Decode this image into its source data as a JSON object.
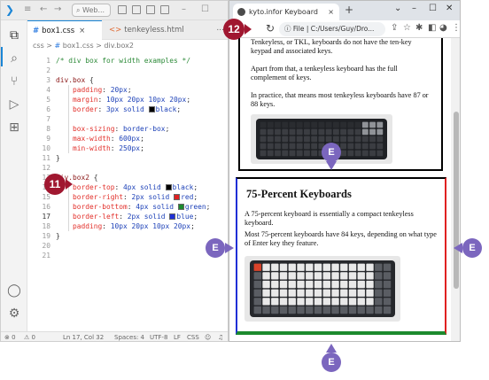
{
  "vscode": {
    "title_search": "Web...",
    "tabs": [
      {
        "lang": "#",
        "label": "box1.css",
        "close": "×"
      },
      {
        "lang": "<>",
        "label": "tenkeyless.html",
        "close": ""
      }
    ],
    "tabs_more": "...",
    "breadcrumb": {
      "file": "css",
      "sep": ">",
      "hash": "#",
      "name": "box1.css",
      "sep2": ">",
      "selector": "div.box2"
    },
    "lines": [
      {
        "n": "1",
        "tokens": [
          [
            "c-com",
            "/* div box for width examples */"
          ]
        ]
      },
      {
        "n": "2",
        "tokens": []
      },
      {
        "n": "3",
        "tokens": [
          [
            "c-sel",
            "div.box"
          ],
          [
            "",
            " {"
          ]
        ]
      },
      {
        "n": "4",
        "tokens": [
          [
            "",
            "    "
          ],
          [
            "c-prop",
            "padding"
          ],
          [
            "",
            ": "
          ],
          [
            "c-val",
            "20px"
          ],
          [
            "",
            ";"
          ]
        ]
      },
      {
        "n": "5",
        "tokens": [
          [
            "",
            "    "
          ],
          [
            "c-prop",
            "margin"
          ],
          [
            "",
            ": "
          ],
          [
            "c-val",
            "10px 20px 10px 20px"
          ],
          [
            "",
            ";"
          ]
        ]
      },
      {
        "n": "6",
        "tokens": [
          [
            "",
            "    "
          ],
          [
            "c-prop",
            "border"
          ],
          [
            "",
            ": "
          ],
          [
            "c-val",
            "3px solid "
          ],
          [
            "sw:#000000",
            ""
          ],
          [
            "c-val",
            "black"
          ],
          [
            "",
            ";"
          ]
        ]
      },
      {
        "n": "7",
        "tokens": []
      },
      {
        "n": "8",
        "tokens": [
          [
            "",
            "    "
          ],
          [
            "c-prop",
            "box-sizing"
          ],
          [
            "",
            ": "
          ],
          [
            "c-val",
            "border-box"
          ],
          [
            "",
            ";"
          ]
        ]
      },
      {
        "n": "9",
        "tokens": [
          [
            "",
            "    "
          ],
          [
            "c-prop",
            "max-width"
          ],
          [
            "",
            ": "
          ],
          [
            "c-val",
            "600px"
          ],
          [
            "",
            ";"
          ]
        ]
      },
      {
        "n": "10",
        "tokens": [
          [
            "",
            "    "
          ],
          [
            "c-prop",
            "min-width"
          ],
          [
            "",
            ": "
          ],
          [
            "c-val",
            "250px"
          ],
          [
            "",
            ";"
          ]
        ]
      },
      {
        "n": "11",
        "tokens": [
          [
            "",
            "}"
          ]
        ]
      },
      {
        "n": "12",
        "tokens": []
      },
      {
        "n": "13",
        "tokens": [
          [
            "c-sel",
            "div.box2"
          ],
          [
            "",
            " {"
          ]
        ]
      },
      {
        "n": "14",
        "tokens": [
          [
            "",
            "    "
          ],
          [
            "c-prop",
            "border-top"
          ],
          [
            "",
            ": "
          ],
          [
            "c-val",
            "4px solid "
          ],
          [
            "sw:#000000",
            ""
          ],
          [
            "c-val",
            "black"
          ],
          [
            "",
            ";"
          ]
        ]
      },
      {
        "n": "15",
        "tokens": [
          [
            "",
            "    "
          ],
          [
            "c-prop",
            "border-right"
          ],
          [
            "",
            ": "
          ],
          [
            "c-val",
            "2px solid "
          ],
          [
            "sw:#e02020",
            ""
          ],
          [
            "c-val",
            "red"
          ],
          [
            "",
            ";"
          ]
        ]
      },
      {
        "n": "16",
        "tokens": [
          [
            "",
            "    "
          ],
          [
            "c-prop",
            "border-bottom"
          ],
          [
            "",
            ": "
          ],
          [
            "c-val",
            "4px solid "
          ],
          [
            "sw:#1c8a2e",
            ""
          ],
          [
            "c-val",
            "green"
          ],
          [
            "",
            ";"
          ]
        ]
      },
      {
        "n": "17",
        "tokens": [
          [
            "",
            "    "
          ],
          [
            "c-prop",
            "border-left"
          ],
          [
            "",
            ": "
          ],
          [
            "c-val",
            "2px solid "
          ],
          [
            "sw:#1f2fd6",
            ""
          ],
          [
            "c-val",
            "blue"
          ],
          [
            "",
            ";"
          ]
        ]
      },
      {
        "n": "18",
        "tokens": [
          [
            "",
            "    "
          ],
          [
            "c-prop",
            "padding"
          ],
          [
            "",
            ": "
          ],
          [
            "c-val",
            "10px 20px 10px 20px"
          ],
          [
            "",
            ";"
          ]
        ]
      },
      {
        "n": "19",
        "tokens": [
          [
            "",
            "}"
          ]
        ]
      },
      {
        "n": "20",
        "tokens": []
      },
      {
        "n": "21",
        "tokens": []
      }
    ],
    "current_line": "17",
    "status": {
      "errors": "⊗ 0",
      "warnings": "⚠ 0",
      "position": "Ln 17, Col 32",
      "spaces": "Spaces: 4",
      "encoding": "UTF-8",
      "eol": "LF",
      "language": "CSS"
    }
  },
  "browser": {
    "tab_title": "kyto.infor Keyboard Categories",
    "tab_close": "×",
    "new_tab": "+",
    "window_controls": [
      "⌄",
      "–",
      "☐",
      "✕"
    ],
    "address": "File | C:/Users/Guy/Dro...",
    "box1_paragraphs": [
      "Tenkeyless, or TKL, keyboards do not have the ten-key keypad and associated keys.",
      "Apart from that, a tenkeyless keyboard has the full complement of keys.",
      "In practice, that means most tenkeyless keyboards have 87 or 88 keys."
    ],
    "box2_heading": "75-Percent Keyboards",
    "box2_paragraphs": [
      "A 75-percent keyboard is essentially a compact tenkeyless keyboard.",
      "Most 75-percent keyboards have 84 keys, depending on what type of Enter key they feature."
    ]
  },
  "callouts": {
    "step_12": "12",
    "step_11": "11",
    "edge_label": "E"
  },
  "colors": {
    "step_badge": "#a01730",
    "edge_badge": "#7b66be",
    "border_top": "#000000",
    "border_right": "#e02020",
    "border_bottom": "#1c8a2e",
    "border_left": "#1f2fd6"
  }
}
